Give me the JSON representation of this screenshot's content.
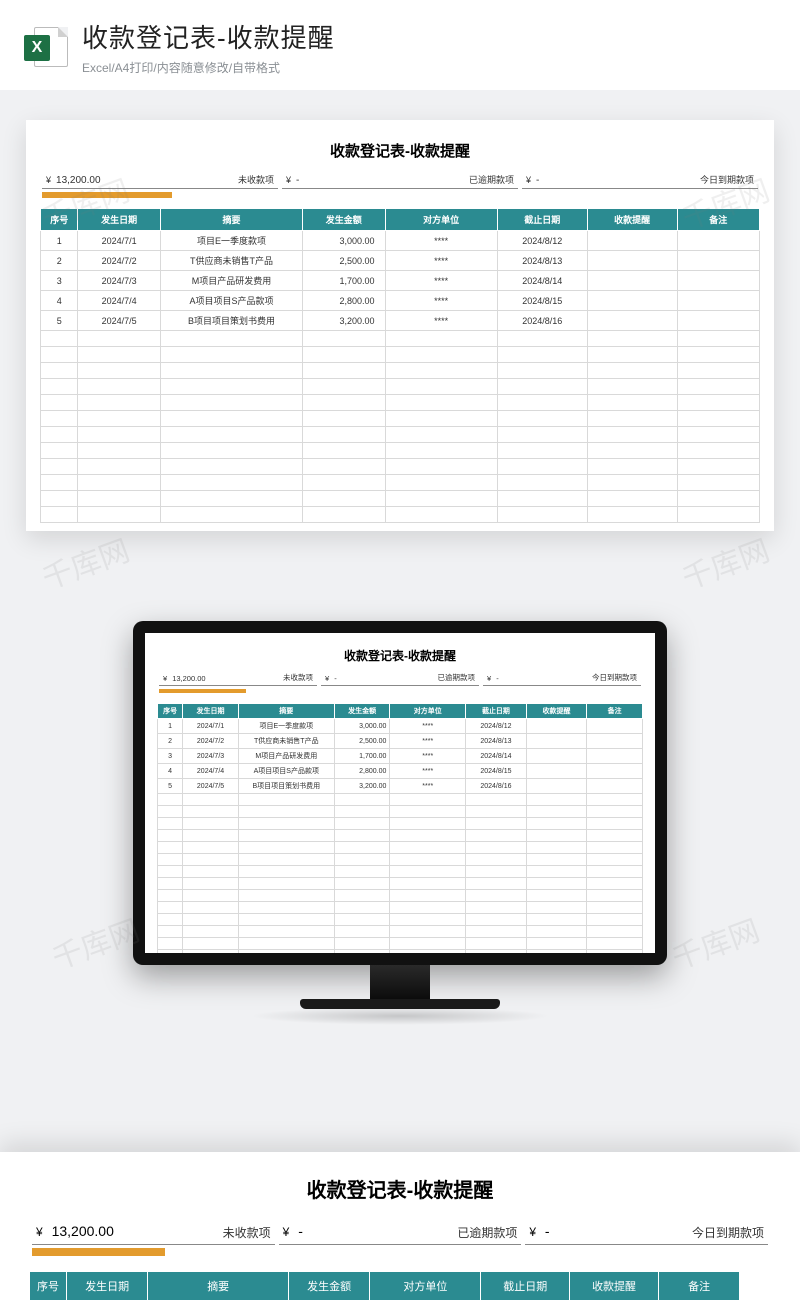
{
  "header": {
    "icon_letter": "X",
    "title": "收款登记表-收款提醒",
    "subtitle": "Excel/A4打印/内容随意修改/自带格式"
  },
  "sheet": {
    "title": "收款登记表-收款提醒",
    "summary": [
      {
        "currency": "¥",
        "amount": "13,200.00",
        "label": "未收款项",
        "has_bar": true
      },
      {
        "currency": "¥",
        "amount": "-",
        "label": "已逾期款项",
        "has_bar": false
      },
      {
        "currency": "¥",
        "amount": "-",
        "label": "今日到期款项",
        "has_bar": false
      }
    ],
    "columns": [
      "序号",
      "发生日期",
      "摘要",
      "发生金额",
      "对方单位",
      "截止日期",
      "收款提醒",
      "备注"
    ],
    "rows": [
      {
        "seq": "1",
        "date": "2024/7/1",
        "desc": "项目E一季度款项",
        "amount": "3,000.00",
        "party": "****",
        "due": "2024/8/12",
        "remind": "",
        "note": ""
      },
      {
        "seq": "2",
        "date": "2024/7/2",
        "desc": "T供应商未销售T产品",
        "amount": "2,500.00",
        "party": "****",
        "due": "2024/8/13",
        "remind": "",
        "note": ""
      },
      {
        "seq": "3",
        "date": "2024/7/3",
        "desc": "M项目产品研发费用",
        "amount": "1,700.00",
        "party": "****",
        "due": "2024/8/14",
        "remind": "",
        "note": ""
      },
      {
        "seq": "4",
        "date": "2024/7/4",
        "desc": "A项目项目S产品款项",
        "amount": "2,800.00",
        "party": "****",
        "due": "2024/8/15",
        "remind": "",
        "note": ""
      },
      {
        "seq": "5",
        "date": "2024/7/5",
        "desc": "B项目项目策划书费用",
        "amount": "3,200.00",
        "party": "****",
        "due": "2024/8/16",
        "remind": "",
        "note": ""
      }
    ],
    "empty_rows": 12
  },
  "watermark_text": "千库网",
  "chart_data": {
    "type": "table",
    "title": "收款登记表-收款提醒",
    "summary_metrics": [
      {
        "label": "未收款项",
        "value": 13200.0,
        "currency": "CNY"
      },
      {
        "label": "已逾期款项",
        "value": null,
        "currency": "CNY"
      },
      {
        "label": "今日到期款项",
        "value": null,
        "currency": "CNY"
      }
    ],
    "columns": [
      "序号",
      "发生日期",
      "摘要",
      "发生金额",
      "对方单位",
      "截止日期",
      "收款提醒",
      "备注"
    ],
    "records": [
      [
        1,
        "2024/7/1",
        "项目E一季度款项",
        3000.0,
        "****",
        "2024/8/12",
        "",
        ""
      ],
      [
        2,
        "2024/7/2",
        "T供应商未销售T产品",
        2500.0,
        "****",
        "2024/8/13",
        "",
        ""
      ],
      [
        3,
        "2024/7/3",
        "M项目产品研发费用",
        1700.0,
        "****",
        "2024/8/14",
        "",
        ""
      ],
      [
        4,
        "2024/7/4",
        "A项目项目S产品款项",
        2800.0,
        "****",
        "2024/8/15",
        "",
        ""
      ],
      [
        5,
        "2024/7/5",
        "B项目项目策划书费用",
        3200.0,
        "****",
        "2024/8/16",
        "",
        ""
      ]
    ]
  }
}
